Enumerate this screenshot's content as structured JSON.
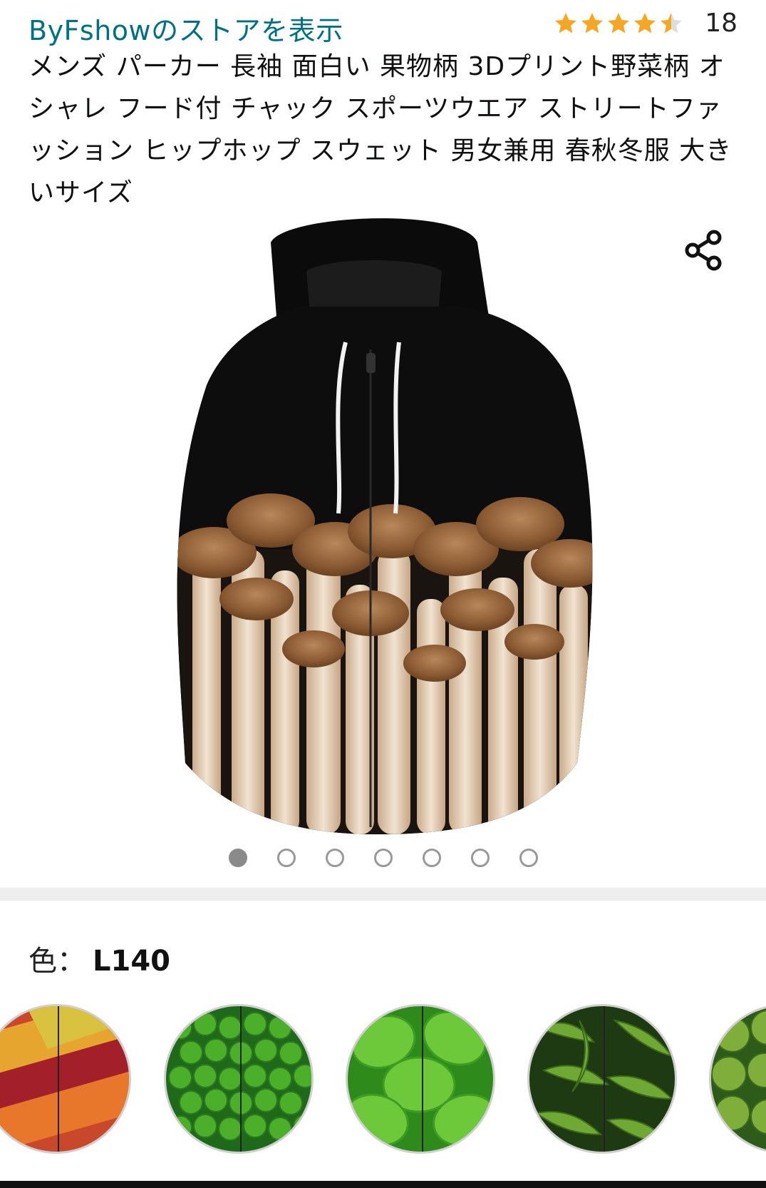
{
  "store": {
    "link_text": "ByFshowのストアを表示"
  },
  "rating": {
    "stars": 4.5,
    "count": "18",
    "star_color": "#f5a623"
  },
  "product": {
    "title": "メンズ パーカー 長袖 面白い 果物柄 3Dプリント野菜柄 オシャレ フード付 チャック スポーツウエア ストリートファッション ヒップホップ スウェット 男女兼用 春秋冬服 大きいサイズ"
  },
  "share": {
    "icon": "share-icon"
  },
  "gallery": {
    "total": 7,
    "active": 1
  },
  "color_selector": {
    "label": "色：",
    "value": "L140"
  },
  "swatches": [
    {
      "name": "mixed-vegetables"
    },
    {
      "name": "peas"
    },
    {
      "name": "lettuce"
    },
    {
      "name": "peppers"
    },
    {
      "name": "brussels-sprouts"
    }
  ],
  "colors": {
    "link": "#007185",
    "divider": "#eeeeee"
  }
}
